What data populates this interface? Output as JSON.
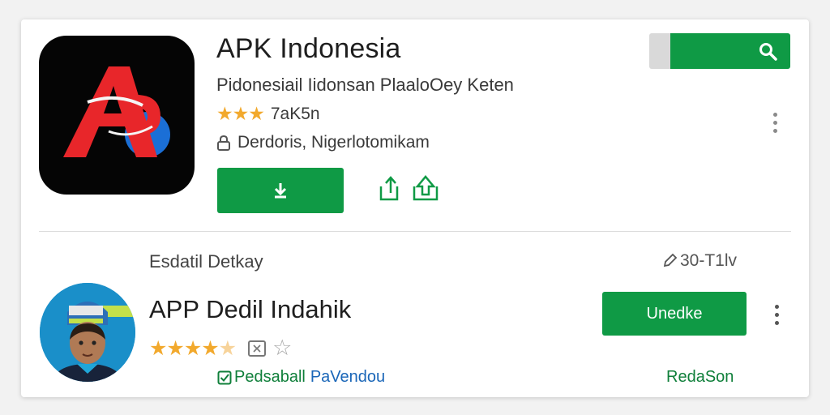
{
  "app1": {
    "title": "APK Indonesia",
    "subtitle": "Pidonesiail Iidonsan PlaaloOey Keten",
    "rating_stars": "★★★",
    "rating_text": "7aK5n",
    "developer": "Derdoris, Nigerlotomikam",
    "icon": "apk-logo-icon"
  },
  "search": {
    "icon": "search-icon",
    "accent": "#0f9a45"
  },
  "actions": {
    "download_icon": "download-icon",
    "share_icons": [
      "share-icon",
      "share-icon"
    ]
  },
  "section": {
    "title": "Esdatil Detkay",
    "meta": "30-T1lv"
  },
  "app2": {
    "title": "APP  Dedil Indahik",
    "rating_stars": "★★★★",
    "half_star": "★",
    "empty_star": "☆",
    "developer_main": "Pedsaball",
    "developer_accent": "PaVendou",
    "button_label": "Unedke",
    "right_label": "RedaSon"
  },
  "colors": {
    "accent_green": "#0f9a45",
    "star": "#f2a92d",
    "logo_red": "#e8262a",
    "logo_blue": "#1b6fd6"
  }
}
